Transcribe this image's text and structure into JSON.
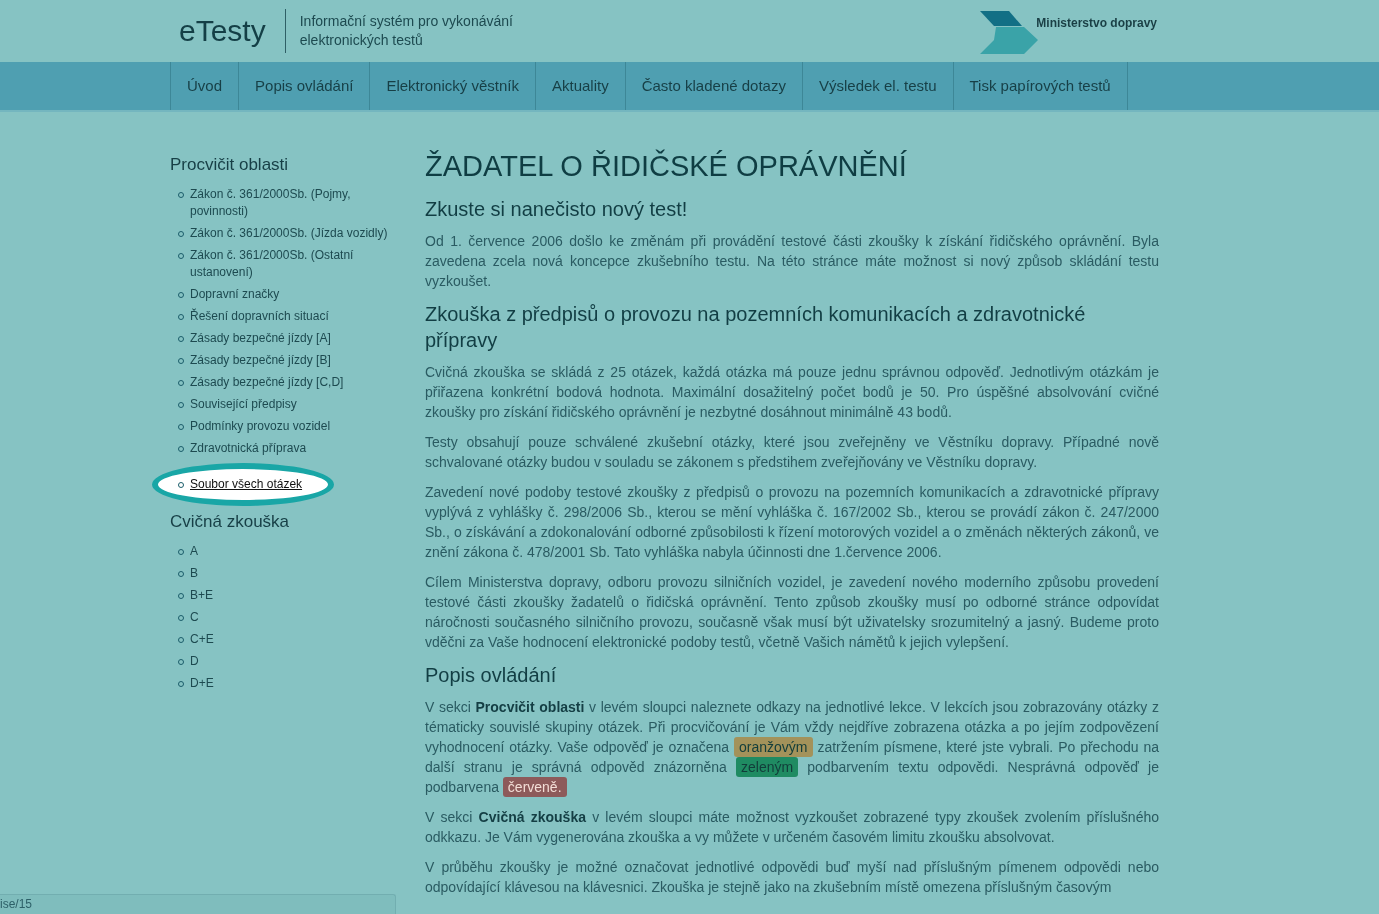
{
  "header": {
    "logo": "eTesty",
    "subtitle": "Informační systém pro vykonávání elektronických testů",
    "ministry": "Ministerstvo dopravy"
  },
  "nav": [
    "Úvod",
    "Popis ovládání",
    "Elektronický věstník",
    "Aktuality",
    "Často kladené dotazy",
    "Výsledek el. testu",
    "Tisk papírových testů"
  ],
  "sidebar": [
    {
      "title": "Procvičit oblasti",
      "items": [
        {
          "label": "Zákon č. 361/2000Sb. (Pojmy, povinnosti)",
          "circled": false
        },
        {
          "label": "Zákon č. 361/2000Sb. (Jízda vozidly)",
          "circled": false
        },
        {
          "label": "Zákon č. 361/2000Sb. (Ostatní ustanovení)",
          "circled": false
        },
        {
          "label": "Dopravní značky",
          "circled": false
        },
        {
          "label": "Řešení dopravních situací",
          "circled": false
        },
        {
          "label": "Zásady bezpečné jízdy [A]",
          "circled": false
        },
        {
          "label": "Zásady bezpečné jízdy [B]",
          "circled": false
        },
        {
          "label": "Zásady bezpečné jízdy [C,D]",
          "circled": false
        },
        {
          "label": "Související předpisy",
          "circled": false
        },
        {
          "label": "Podmínky provozu vozidel",
          "circled": false
        },
        {
          "label": "Zdravotnická příprava",
          "circled": false
        },
        {
          "label": "Soubor všech otázek",
          "circled": true
        }
      ]
    },
    {
      "title": "Cvičná zkouška",
      "items": [
        {
          "label": "A",
          "circled": false
        },
        {
          "label": "B",
          "circled": false
        },
        {
          "label": "B+E",
          "circled": false
        },
        {
          "label": "C",
          "circled": false
        },
        {
          "label": "C+E",
          "circled": false
        },
        {
          "label": "D",
          "circled": false
        },
        {
          "label": "D+E",
          "circled": false
        }
      ]
    }
  ],
  "content": {
    "title": "ŽADATEL O ŘIDIČSKÉ OPRÁVNĚNÍ",
    "blocks": [
      {
        "kind": "heading",
        "text": "Zkuste si nanečisto nový test!"
      },
      {
        "kind": "paragraph",
        "parts": [
          {
            "kind": "text",
            "text": "Od 1. července 2006 došlo ke změnám při provádění testové části zkoušky k získání řidičského oprávnění. Byla zavedena zcela nová koncepce zkušebního testu. Na této stránce máte možnost si nový způsob skládání testu vyzkoušet."
          }
        ]
      },
      {
        "kind": "heading",
        "text": "Zkouška z předpisů o provozu na pozemních komunikacích a zdravotnické přípravy"
      },
      {
        "kind": "paragraph",
        "parts": [
          {
            "kind": "text",
            "text": "Cvičná zkouška se skládá z 25 otázek, každá otázka má pouze jednu správnou odpověď. Jednotlivým otázkám je přiřazena konkrétní bodová hodnota. Maximální dosažitelný počet bodů je 50. Pro úspěšné absolvování cvičné zkoušky pro získání řidičského oprávnění je nezbytné dosáhnout minimálně 43 bodů."
          }
        ]
      },
      {
        "kind": "paragraph",
        "parts": [
          {
            "kind": "text",
            "text": "Testy obsahují pouze schválené zkušební otázky, které jsou zveřejněny ve Věstníku dopravy. Případné nově schvalované otázky budou v souladu se zákonem s předstihem zveřejňovány ve Věstníku dopravy."
          }
        ]
      },
      {
        "kind": "paragraph",
        "parts": [
          {
            "kind": "text",
            "text": "Zavedení nové podoby testové zkoušky z předpisů o provozu na pozemních komunikacích a zdravotnické přípravy vyplývá z vyhlášky č. 298/2006 Sb., kterou se mění vyhláška č. 167/2002 Sb., kterou se provádí zákon č. 247/2000 Sb., o získávání a zdokonalování odborné způsobilosti k řízení motorových vozidel a o změnách některých zákonů, ve znění zákona č. 478/2001 Sb. Tato vyhláška nabyla účinnosti dne 1.července 2006."
          }
        ]
      },
      {
        "kind": "paragraph",
        "parts": [
          {
            "kind": "text",
            "text": "Cílem Ministerstva dopravy, odboru provozu silničních vozidel, je zavedení nového moderního způsobu provedení testové části zkoušky žadatelů o řidičská oprávnění. Tento způsob zkoušky musí po odborné stránce odpovídat náročnosti současného silničního provozu, současně však musí být uživatelsky srozumitelný a jasný. Budeme proto vděčni za Vaše hodnocení elektronické podoby testů, včetně Vašich námětů k jejich vylepšení."
          }
        ]
      },
      {
        "kind": "heading",
        "text": "Popis ovládání"
      },
      {
        "kind": "paragraph",
        "parts": [
          {
            "kind": "text",
            "text": "V sekci **Procvičit oblasti** v levém sloupci naleznete odkazy na jednotlivé lekce. V lekcích jsou zobrazovány otázky z tématicky souvislé skupiny otázek. Při procvičování je Vám vždy nejdříve zobrazena otázka a po jejím zodpovězení vyhodnocení otázky. Vaše odpověď je označena "
          },
          {
            "kind": "mark",
            "text": "oranžovým",
            "color": "#a3925a"
          },
          {
            "kind": "text",
            "text": " zatržením písmene, které jste vybrali. Po přechodu na další stranu je správná odpověd znázorněna "
          },
          {
            "kind": "mark",
            "text": "zeleným",
            "color": "#1f8b62"
          },
          {
            "kind": "text",
            "text": " podbarvením textu odpovědi. Nesprávná odpověď je podbarvena "
          },
          {
            "kind": "mark",
            "text": "červeně.",
            "color": "#8d5a5a"
          }
        ]
      },
      {
        "kind": "paragraph",
        "parts": [
          {
            "kind": "text",
            "text": "V sekci **Cvičná zkouška** v levém sloupci máte možnost vyzkoušet zobrazené typy zkoušek zvolením příslušného odkkazu. Je Vám vygenerována zkouška a vy můžete v určeném časovém limitu zkoušku absolvovat."
          }
        ]
      },
      {
        "kind": "paragraph",
        "parts": [
          {
            "kind": "text",
            "text": "V průběhu zkoušky je možné označovat jednotlivé odpovědi buď myší nad příslušným pímenem odpovědi nebo odpovídající klávesou na klávesnici. Zkouška je stejně jako na zkušebním místě omezena příslušným časovým"
          }
        ]
      }
    ]
  },
  "status_bar": {
    "text": "ise/15"
  }
}
